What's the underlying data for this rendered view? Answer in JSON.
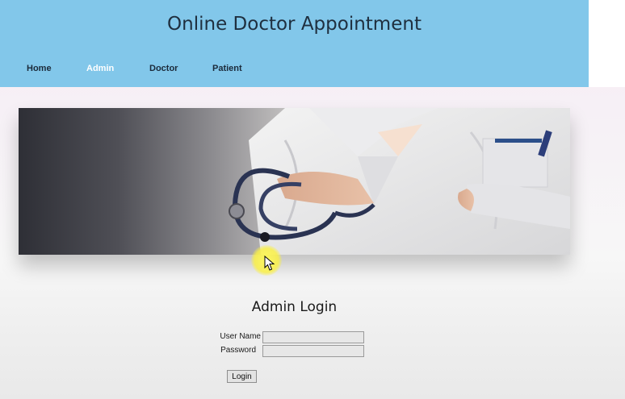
{
  "header": {
    "title": "Online Doctor Appointment",
    "nav": [
      {
        "label": "Home",
        "active": false
      },
      {
        "label": "Admin",
        "active": true
      },
      {
        "label": "Doctor",
        "active": false
      },
      {
        "label": "Patient",
        "active": false
      }
    ]
  },
  "banner": {
    "image": "doctor-with-stethoscope"
  },
  "login": {
    "title": "Admin Login",
    "username_label": "User Name",
    "password_label": "Password",
    "username_value": "",
    "password_value": "",
    "button_label": "Login"
  },
  "colors": {
    "header_bg": "#82c7ea",
    "active_nav": "#ffffff"
  }
}
